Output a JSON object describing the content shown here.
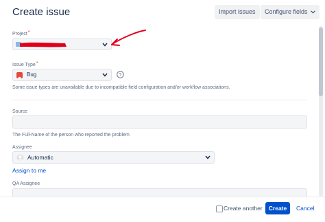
{
  "header": {
    "title": "Create issue",
    "import_label": "Import issues",
    "configure_label": "Configure fields"
  },
  "form": {
    "project": {
      "label": "Project",
      "required_mark": "*"
    },
    "issue_type": {
      "label": "Issue Type",
      "required_mark": "*",
      "value": "Bug",
      "note": "Some issue types are unavailable due to incompatible field configuration and/or workflow associations."
    },
    "source": {
      "label": "Source",
      "value": "",
      "help": "The Full-Name of the person who reported the problem"
    },
    "assignee": {
      "label": "Assignee",
      "value": "Automatic",
      "assign_to_me": "Assign to me"
    },
    "qa_assignee": {
      "label": "QA Assignee"
    }
  },
  "footer": {
    "create_another_label": "Create another",
    "create_another_checked": false,
    "create_label": "Create",
    "cancel_label": "Cancel"
  },
  "colors": {
    "primary": "#0052cc",
    "annotation": "#e0001a",
    "bug_icon": "#e5493a"
  }
}
